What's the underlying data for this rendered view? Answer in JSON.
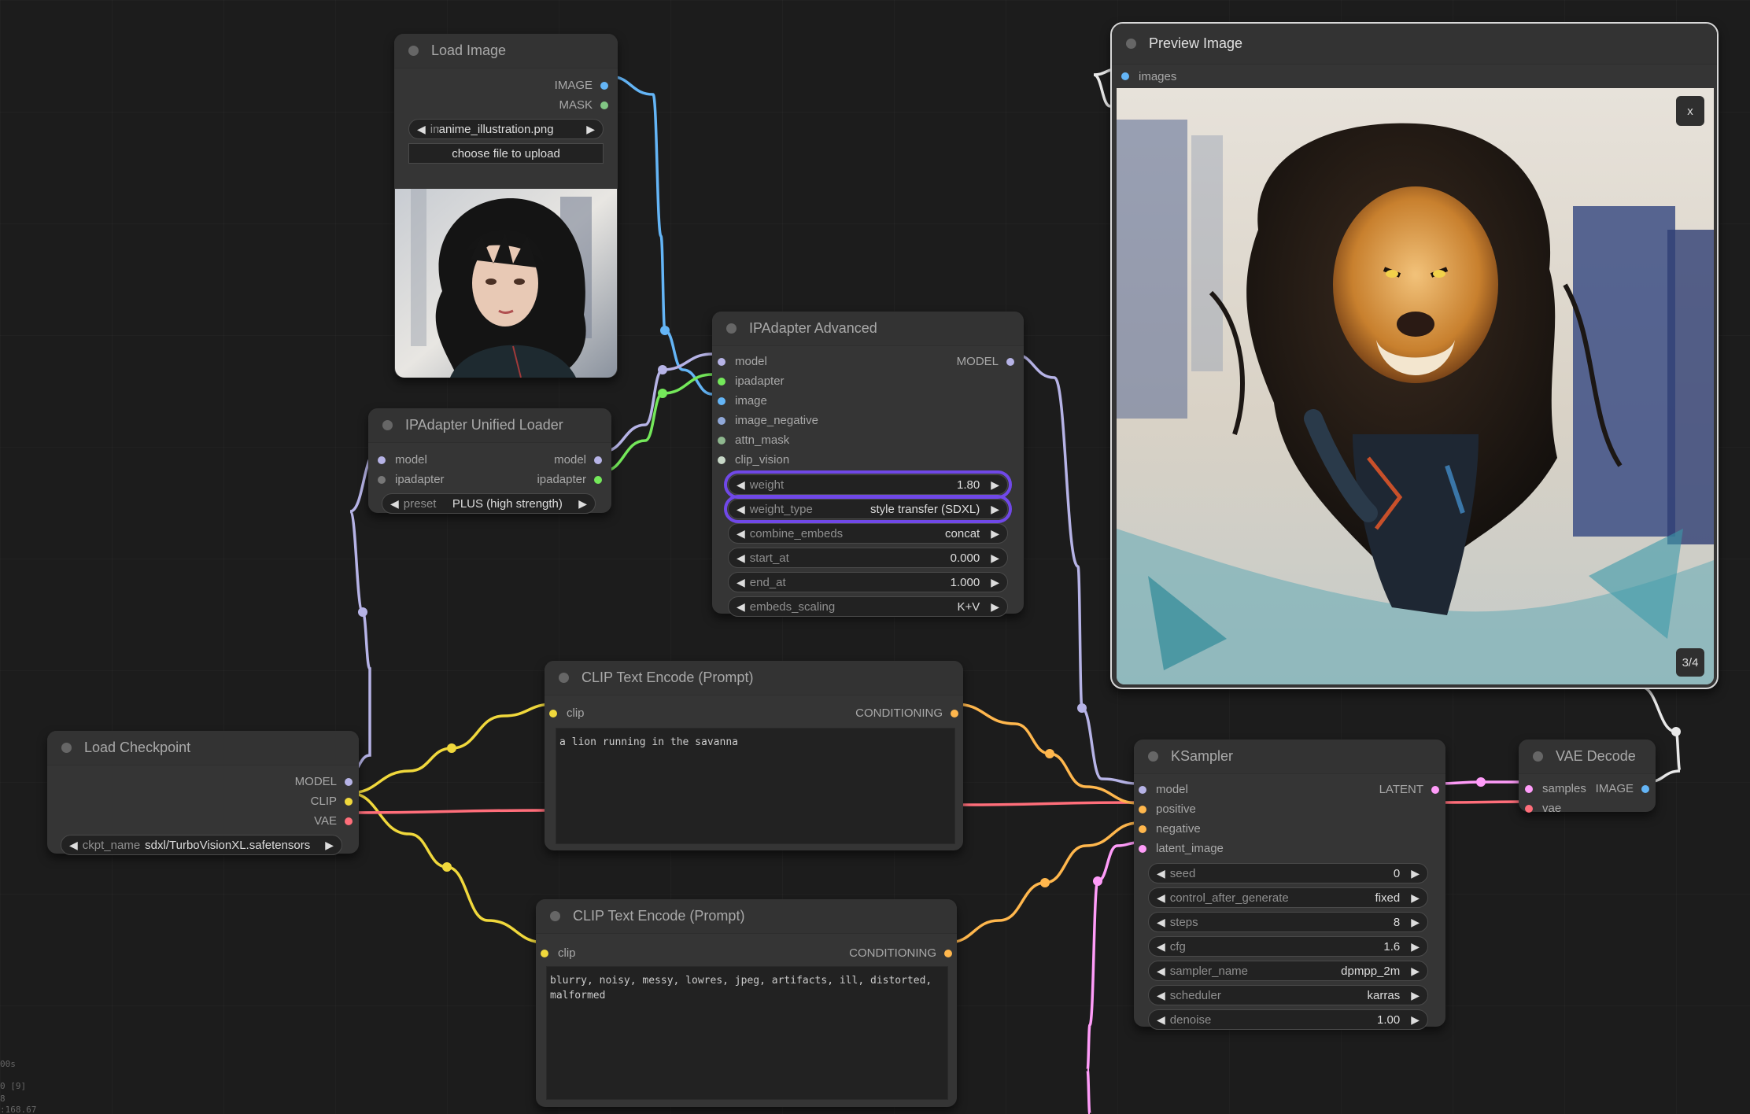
{
  "colors": {
    "model": "#b6b3e6",
    "clip": "#f0d83c",
    "vae": "#ff6e7a",
    "image": "#64b5f6",
    "mask": "#81c784",
    "ipadapter": "#74e85a",
    "conditioning": "#ffb74d",
    "latent": "#ff9cf9",
    "highlight": "#7048e8",
    "link_image_out": "#e8e8e8"
  },
  "nodes": {
    "load_image": {
      "title": "Load Image",
      "outputs": [
        "IMAGE",
        "MASK"
      ],
      "widget_label": "image",
      "widget_value": "anime_illustration.png",
      "upload_label": "choose file to upload",
      "image_alt": "anime girl illustration"
    },
    "unified_loader": {
      "title": "IPAdapter Unified Loader",
      "inputs": [
        "model",
        "ipadapter"
      ],
      "outputs": [
        "model",
        "ipadapter"
      ],
      "widget": {
        "label": "preset",
        "value": "PLUS (high strength)"
      }
    },
    "ipadapter_advanced": {
      "title": "IPAdapter Advanced",
      "inputs": [
        "model",
        "ipadapter",
        "image",
        "image_negative",
        "attn_mask",
        "clip_vision"
      ],
      "outputs": [
        "MODEL"
      ],
      "widgets": [
        {
          "label": "weight",
          "value": "1.80",
          "highlighted": true
        },
        {
          "label": "weight_type",
          "value": "style transfer (SDXL)",
          "highlighted": true
        },
        {
          "label": "combine_embeds",
          "value": "concat"
        },
        {
          "label": "start_at",
          "value": "0.000"
        },
        {
          "label": "end_at",
          "value": "1.000"
        },
        {
          "label": "embeds_scaling",
          "value": "K+V"
        }
      ]
    },
    "preview_image": {
      "title": "Preview Image",
      "inputs": [
        "images"
      ],
      "close_label": "x",
      "counter": "3/4",
      "image_alt": "lion running illustration"
    },
    "clip_positive": {
      "title": "CLIP Text Encode (Prompt)",
      "inputs": [
        "clip"
      ],
      "outputs": [
        "CONDITIONING"
      ],
      "text": "a lion running in the savanna"
    },
    "clip_negative": {
      "title": "CLIP Text Encode (Prompt)",
      "inputs": [
        "clip"
      ],
      "outputs": [
        "CONDITIONING"
      ],
      "text": "blurry, noisy, messy, lowres, jpeg, artifacts, ill, distorted,\nmalformed"
    },
    "load_checkpoint": {
      "title": "Load Checkpoint",
      "outputs": [
        "MODEL",
        "CLIP",
        "VAE"
      ],
      "widget": {
        "label": "ckpt_name",
        "value": "sdxl/TurboVisionXL.safetensors"
      }
    },
    "ksampler": {
      "title": "KSampler",
      "inputs": [
        "model",
        "positive",
        "negative",
        "latent_image"
      ],
      "outputs": [
        "LATENT"
      ],
      "widgets": [
        {
          "label": "seed",
          "value": "0"
        },
        {
          "label": "control_after_generate",
          "value": "fixed"
        },
        {
          "label": "steps",
          "value": "8"
        },
        {
          "label": "cfg",
          "value": "1.6"
        },
        {
          "label": "sampler_name",
          "value": "dpmpp_2m"
        },
        {
          "label": "scheduler",
          "value": "karras"
        },
        {
          "label": "denoise",
          "value": "1.00"
        }
      ]
    },
    "vae_decode": {
      "title": "VAE Decode",
      "inputs": [
        "samples",
        "vae"
      ],
      "outputs": [
        "IMAGE"
      ]
    }
  },
  "widget_arrows": {
    "left": "◀",
    "right": "▶"
  },
  "stats": [
    "00s",
    "0 [9]",
    "8",
    ":168.67"
  ]
}
